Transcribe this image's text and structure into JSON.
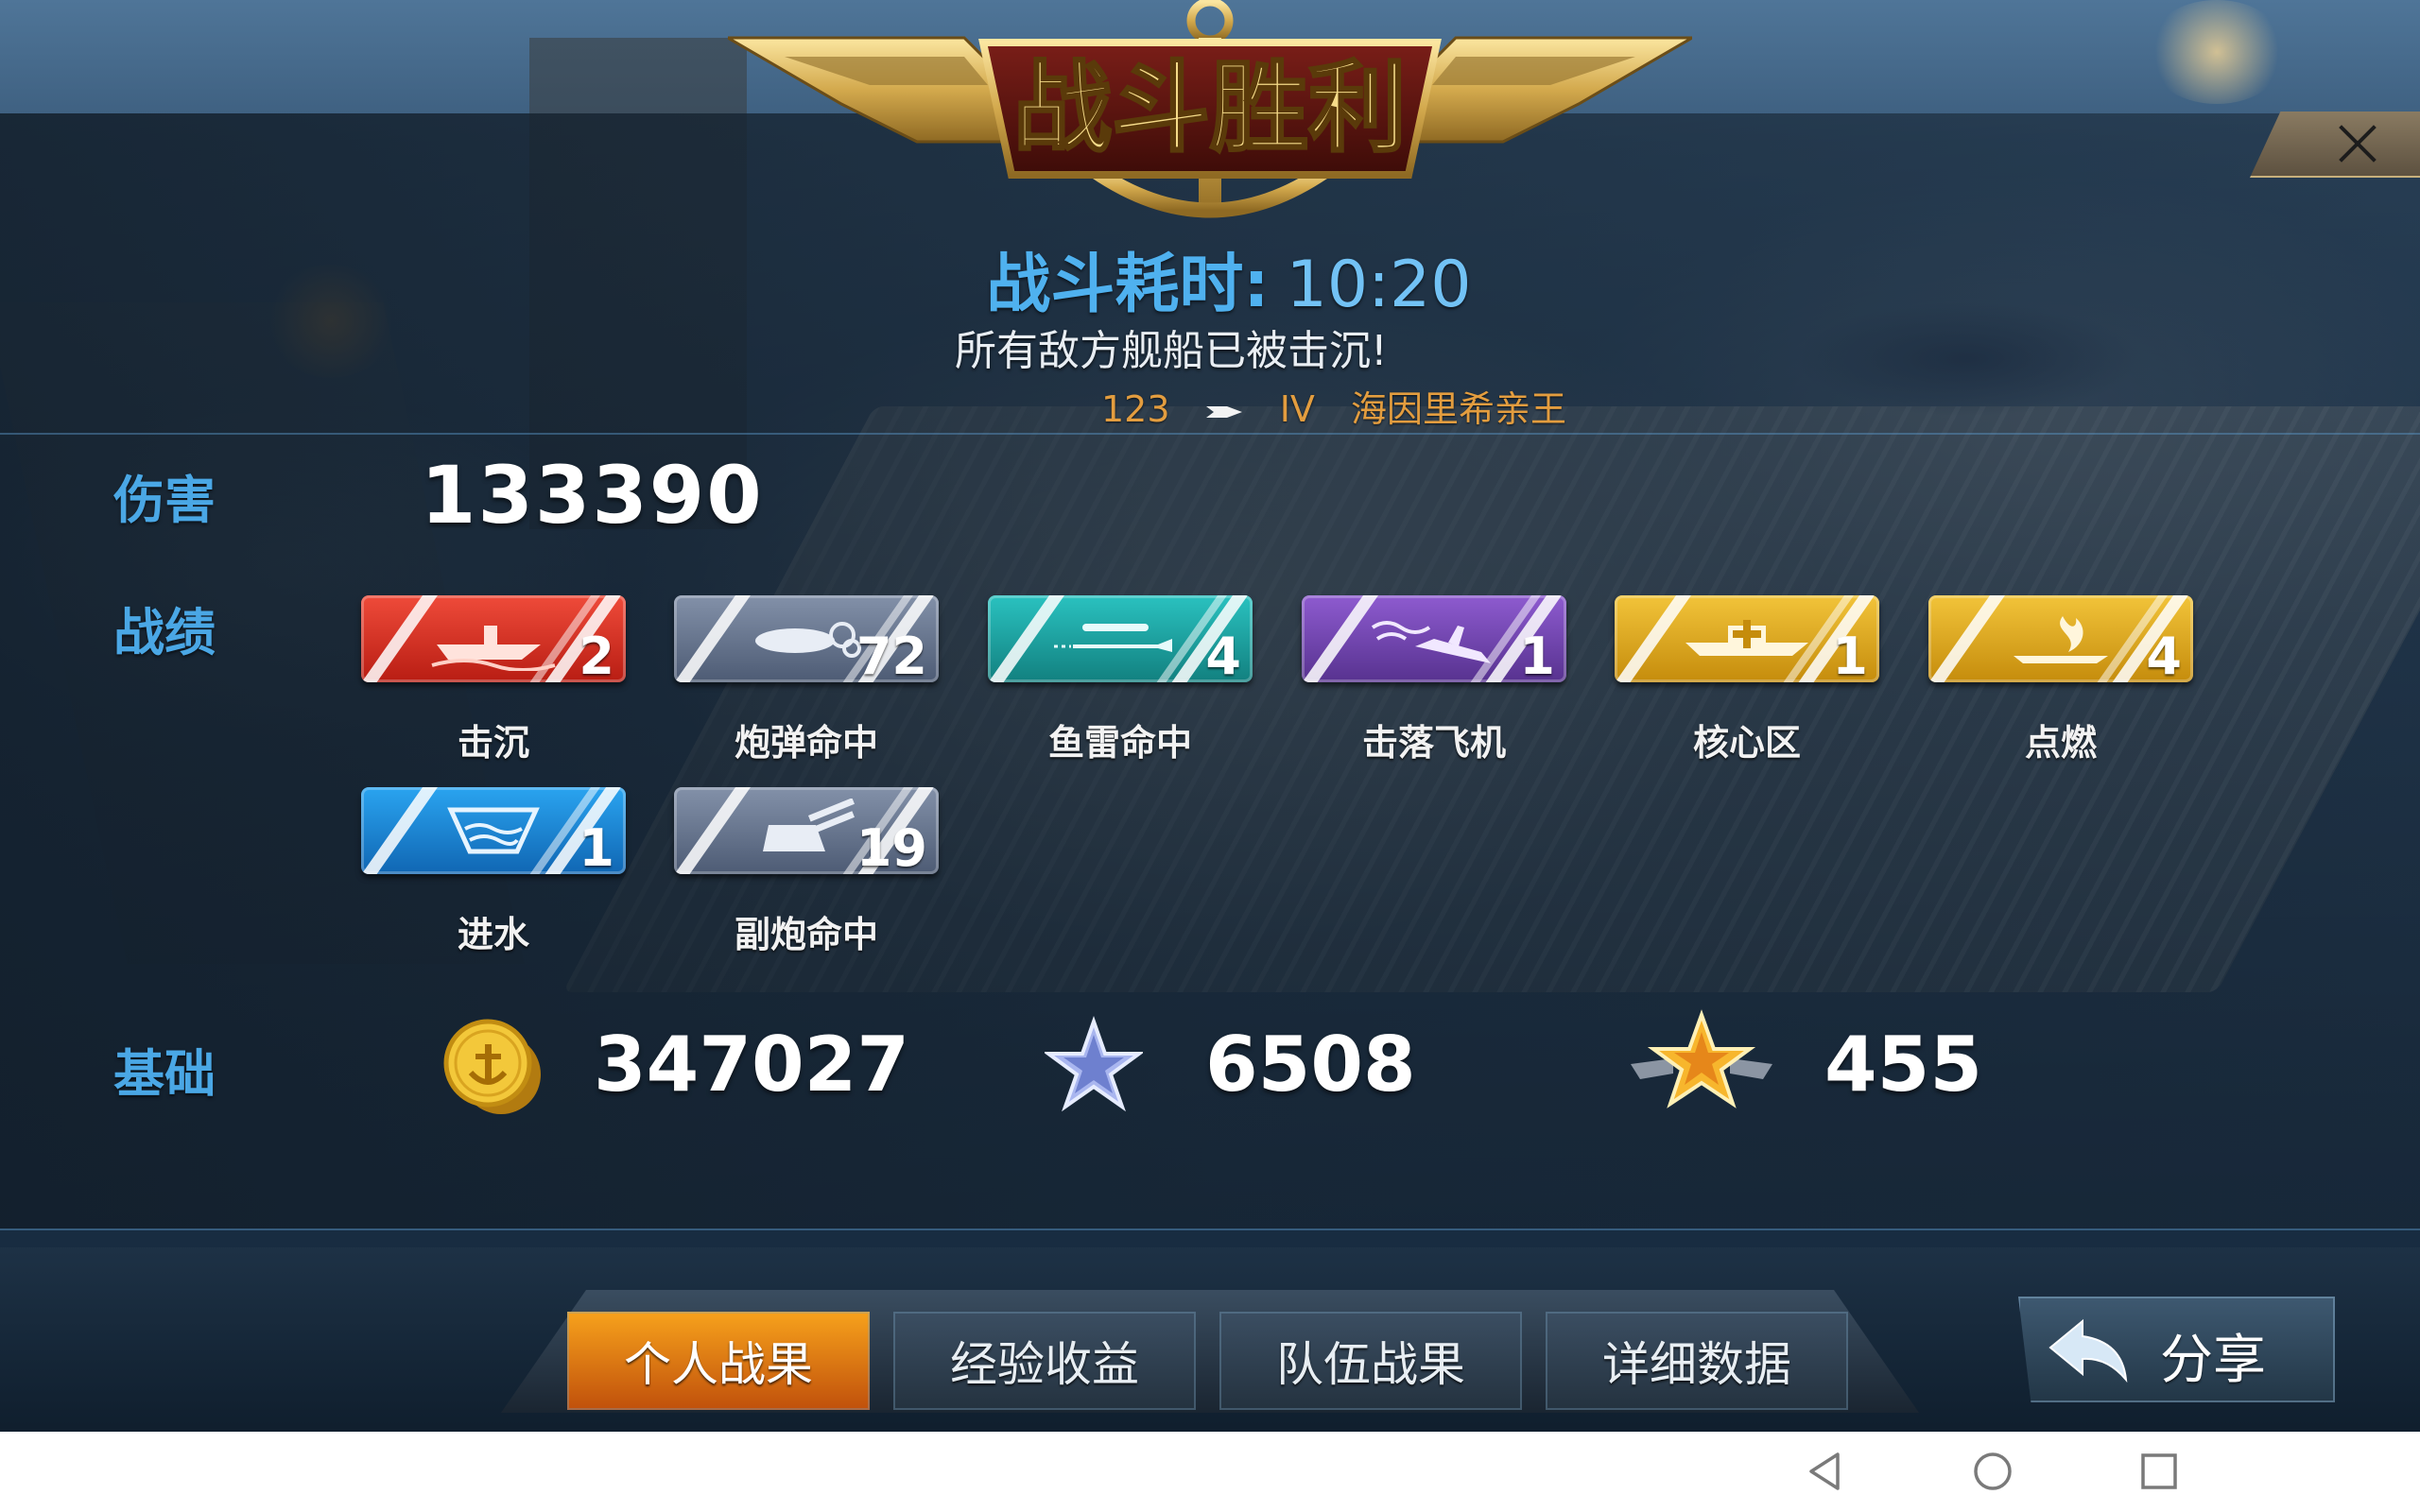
{
  "header": {
    "title": "战斗胜利",
    "close_label": "×"
  },
  "battle": {
    "time_label": "战斗耗时:",
    "time_value": "10:20",
    "message": "所有敌方舰船已被击沉!",
    "ship_number": "123",
    "ship_tier": "IV",
    "ship_name": "海因里希亲王"
  },
  "damage": {
    "label": "伤害",
    "value": "133390"
  },
  "record": {
    "label": "战绩",
    "medals": [
      {
        "label": "击沉",
        "count": "2",
        "color": "#d9302a",
        "icon": "sunk-ship-icon"
      },
      {
        "label": "炮弹命中",
        "count": "72",
        "color": "#66748d",
        "icon": "shell-hit-icon"
      },
      {
        "label": "鱼雷命中",
        "count": "4",
        "color": "#1fa3a2",
        "icon": "torpedo-icon"
      },
      {
        "label": "击落飞机",
        "count": "1",
        "color": "#7146b0",
        "icon": "downed-plane-icon"
      },
      {
        "label": "核心区",
        "count": "1",
        "color": "#dca31d",
        "icon": "citadel-icon"
      },
      {
        "label": "点燃",
        "count": "4",
        "color": "#dca31d",
        "icon": "fire-icon"
      },
      {
        "label": "进水",
        "count": "1",
        "color": "#1c86d5",
        "icon": "flooding-icon"
      },
      {
        "label": "副炮命中",
        "count": "19",
        "color": "#66748d",
        "icon": "secondary-gun-icon"
      }
    ]
  },
  "base": {
    "label": "基础",
    "rewards": [
      {
        "icon": "gold-coin-icon",
        "value": "347027"
      },
      {
        "icon": "silver-star-icon",
        "value": "6508"
      },
      {
        "icon": "gold-star-icon",
        "value": "455"
      }
    ]
  },
  "tabs": [
    {
      "label": "个人战果",
      "active": true
    },
    {
      "label": "经验收益",
      "active": false
    },
    {
      "label": "队伍战果",
      "active": false
    },
    {
      "label": "详细数据",
      "active": false
    }
  ],
  "share": {
    "label": "分享"
  },
  "colors": {
    "accent_blue": "#4aa7e5",
    "tab_active": "#f08a15",
    "ship_text": "#e39d3f"
  }
}
